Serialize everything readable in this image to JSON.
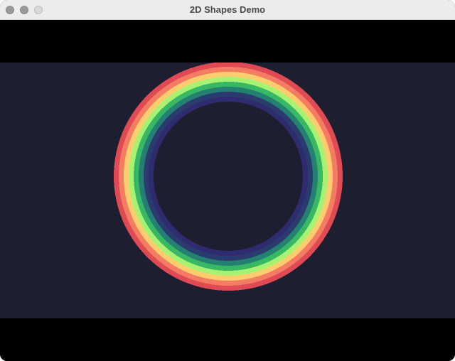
{
  "window": {
    "title": "2D Shapes Demo"
  },
  "colors": {
    "titlebar": "#ececec",
    "letterbox": "#000000",
    "canvas_background": "#1e1e31",
    "ring_inner_fill": "#1e1e31"
  },
  "ring": {
    "band_colors": [
      "#e04a55",
      "#f47c63",
      "#ffcd6e",
      "#a7f272",
      "#38b864",
      "#248071",
      "#2a3b6e",
      "#2e2b6f"
    ]
  }
}
